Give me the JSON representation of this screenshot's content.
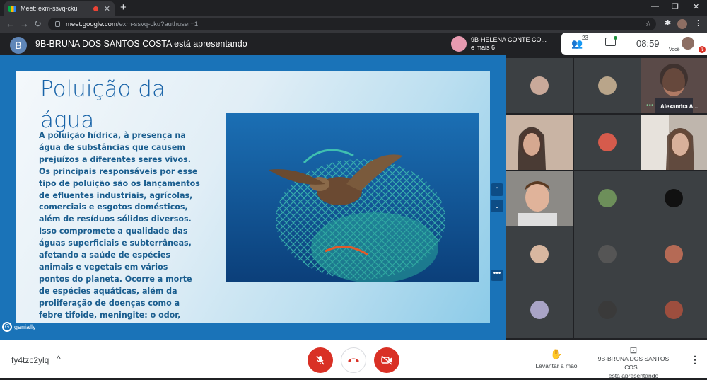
{
  "browser": {
    "tab_title": "Meet: exm-ssvq-cku",
    "tab_close": "✕",
    "new_tab": "+",
    "url_host": "meet.google.com",
    "url_path": "/exm-ssvq-cku?authuser=1"
  },
  "header": {
    "presenter_initial": "B",
    "presenter_text": "9B-BRUNA DOS SANTOS COSTA está apresentando",
    "pinned_name": "9B-HELENA CONTE CO...",
    "pinned_more": "e mais 6",
    "people_count": "23",
    "clock": "08:59",
    "self_label": "Você"
  },
  "slide": {
    "title": "Poluição da água",
    "body": "A poluição hídrica, à presença na água de substâncias que causem prejuízos a diferentes seres vivos. Os principais responsáveis por esse tipo de poluição são os lançamentos de efluentes industriais, agrícolas, comerciais e esgotos domésticos, além de resíduos sólidos diversos. Isso compromete a qualidade das águas superficiais e subterrâneas, afetando a saúde de espécies animais e vegetais em vários pontos do planeta. Ocorre a morte de espécies aquáticas, além da proliferação de doenças como a febre tifoide, meningite: o odor, causa grande concentração de mosquitos.",
    "brand": "genially",
    "brand_mark": "G",
    "nav_up": "⌃",
    "nav_down": "⌄",
    "more": "•••"
  },
  "participants": {
    "named_tile": "Alexandra A...",
    "colors": {
      "avatar_1": "#c9a99a",
      "avatar_2": "#b9a58a",
      "avatar_3": "#d65b4c",
      "avatar_4": "#6d8f5a",
      "avatar_5": "#111111",
      "avatar_6": "#d8b7a0",
      "avatar_7": "#555555",
      "avatar_8": "#b56a55",
      "avatar_9": "#a9a4c6",
      "avatar_10": "#3a3a3a",
      "avatar_11": "#9d4e3e"
    }
  },
  "bottom": {
    "meeting_code": "fy4tzc2ylq",
    "code_chevron": "^",
    "raise_hand": "Levantar a mão",
    "presenter_name": "9B-BRUNA DOS SANTOS COS...",
    "presenter_status": "está apresentando"
  },
  "colors": {
    "accent_red": "#d93025",
    "stage_blue": "#1a73b8",
    "slide_text": "#1b5e8f"
  }
}
